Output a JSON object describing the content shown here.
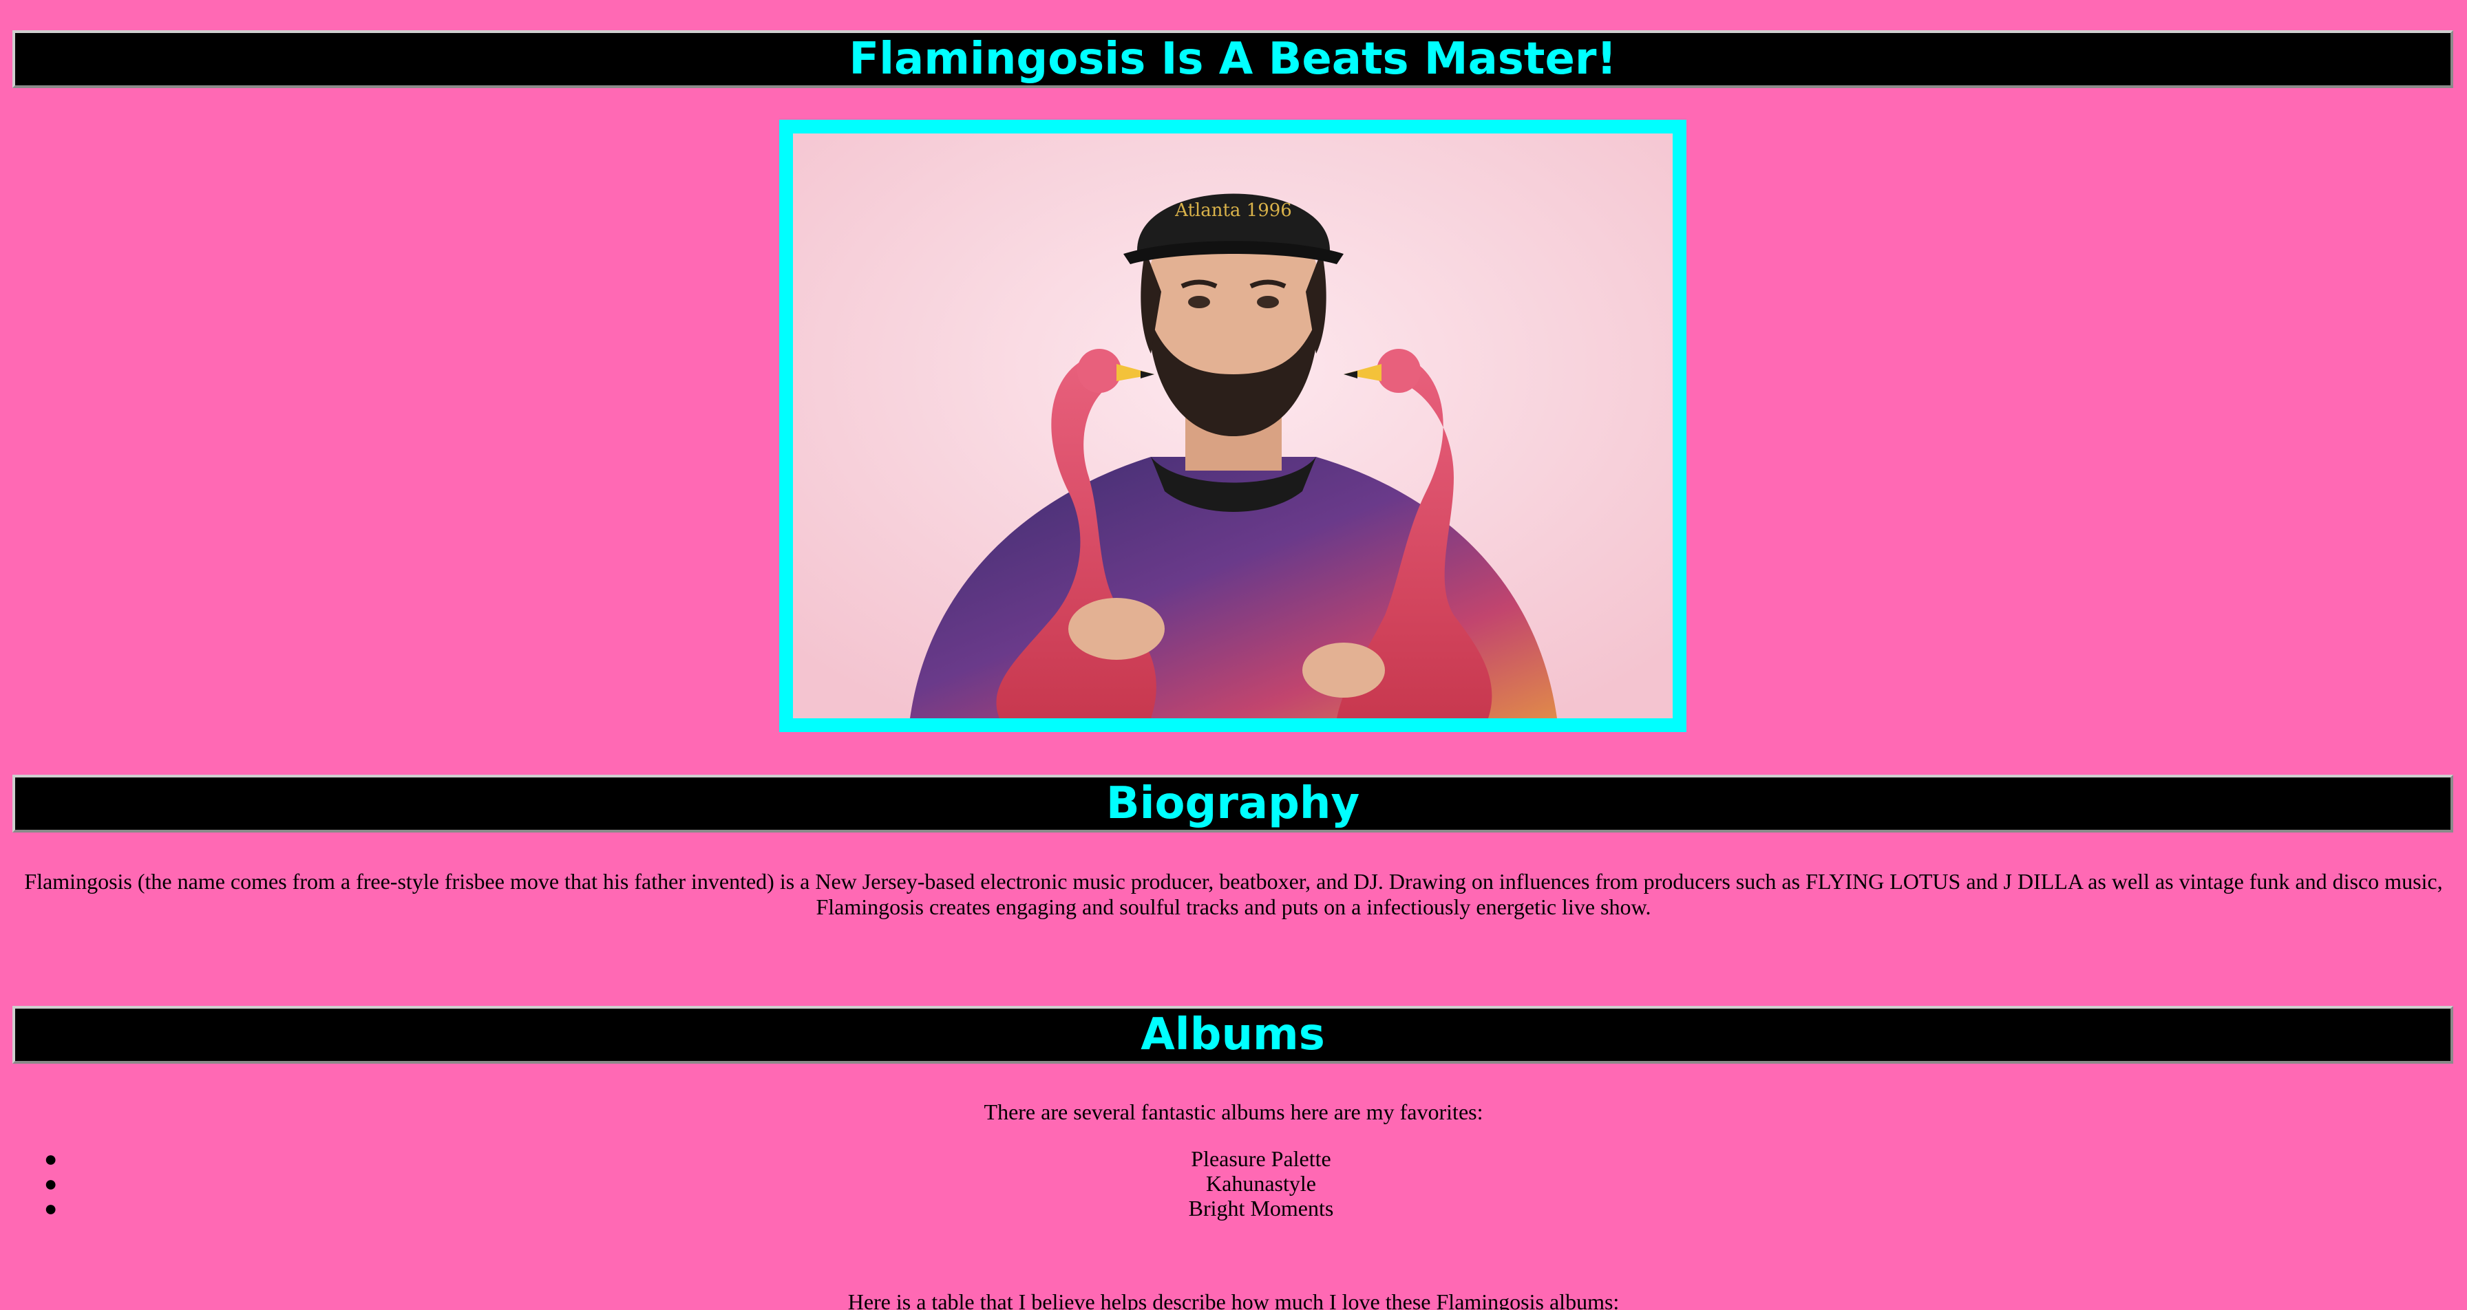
{
  "header": {
    "title": "Flamingosis Is A Beats Master!"
  },
  "photo": {
    "alt": "Flamingosis holding two pink plastic flamingos",
    "cap_text": "Atlanta 1996"
  },
  "biography": {
    "title": "Biography",
    "text": "Flamingosis (the name comes from a free-style frisbee move that his father invented) is a New Jersey-based electronic music producer, beatboxer, and DJ. Drawing on influences from producers such as FLYING LOTUS and J DILLA as well as vintage funk and disco music, Flamingosis creates engaging and soulful tracks and puts on a infectiously energetic live show."
  },
  "albums": {
    "title": "Albums",
    "intro": "There are several fantastic albums here are my favorites:",
    "items": [
      {
        "label": "Pleasure Palette"
      },
      {
        "label": "Kahunastyle"
      },
      {
        "label": "Bright Moments"
      }
    ],
    "table_intro": "Here is a table that I believe helps describe how much I love these Flamingosis albums:"
  },
  "colors": {
    "background": "#ff69b4",
    "accent": "#00ffff",
    "heading_bg": "#000000"
  }
}
